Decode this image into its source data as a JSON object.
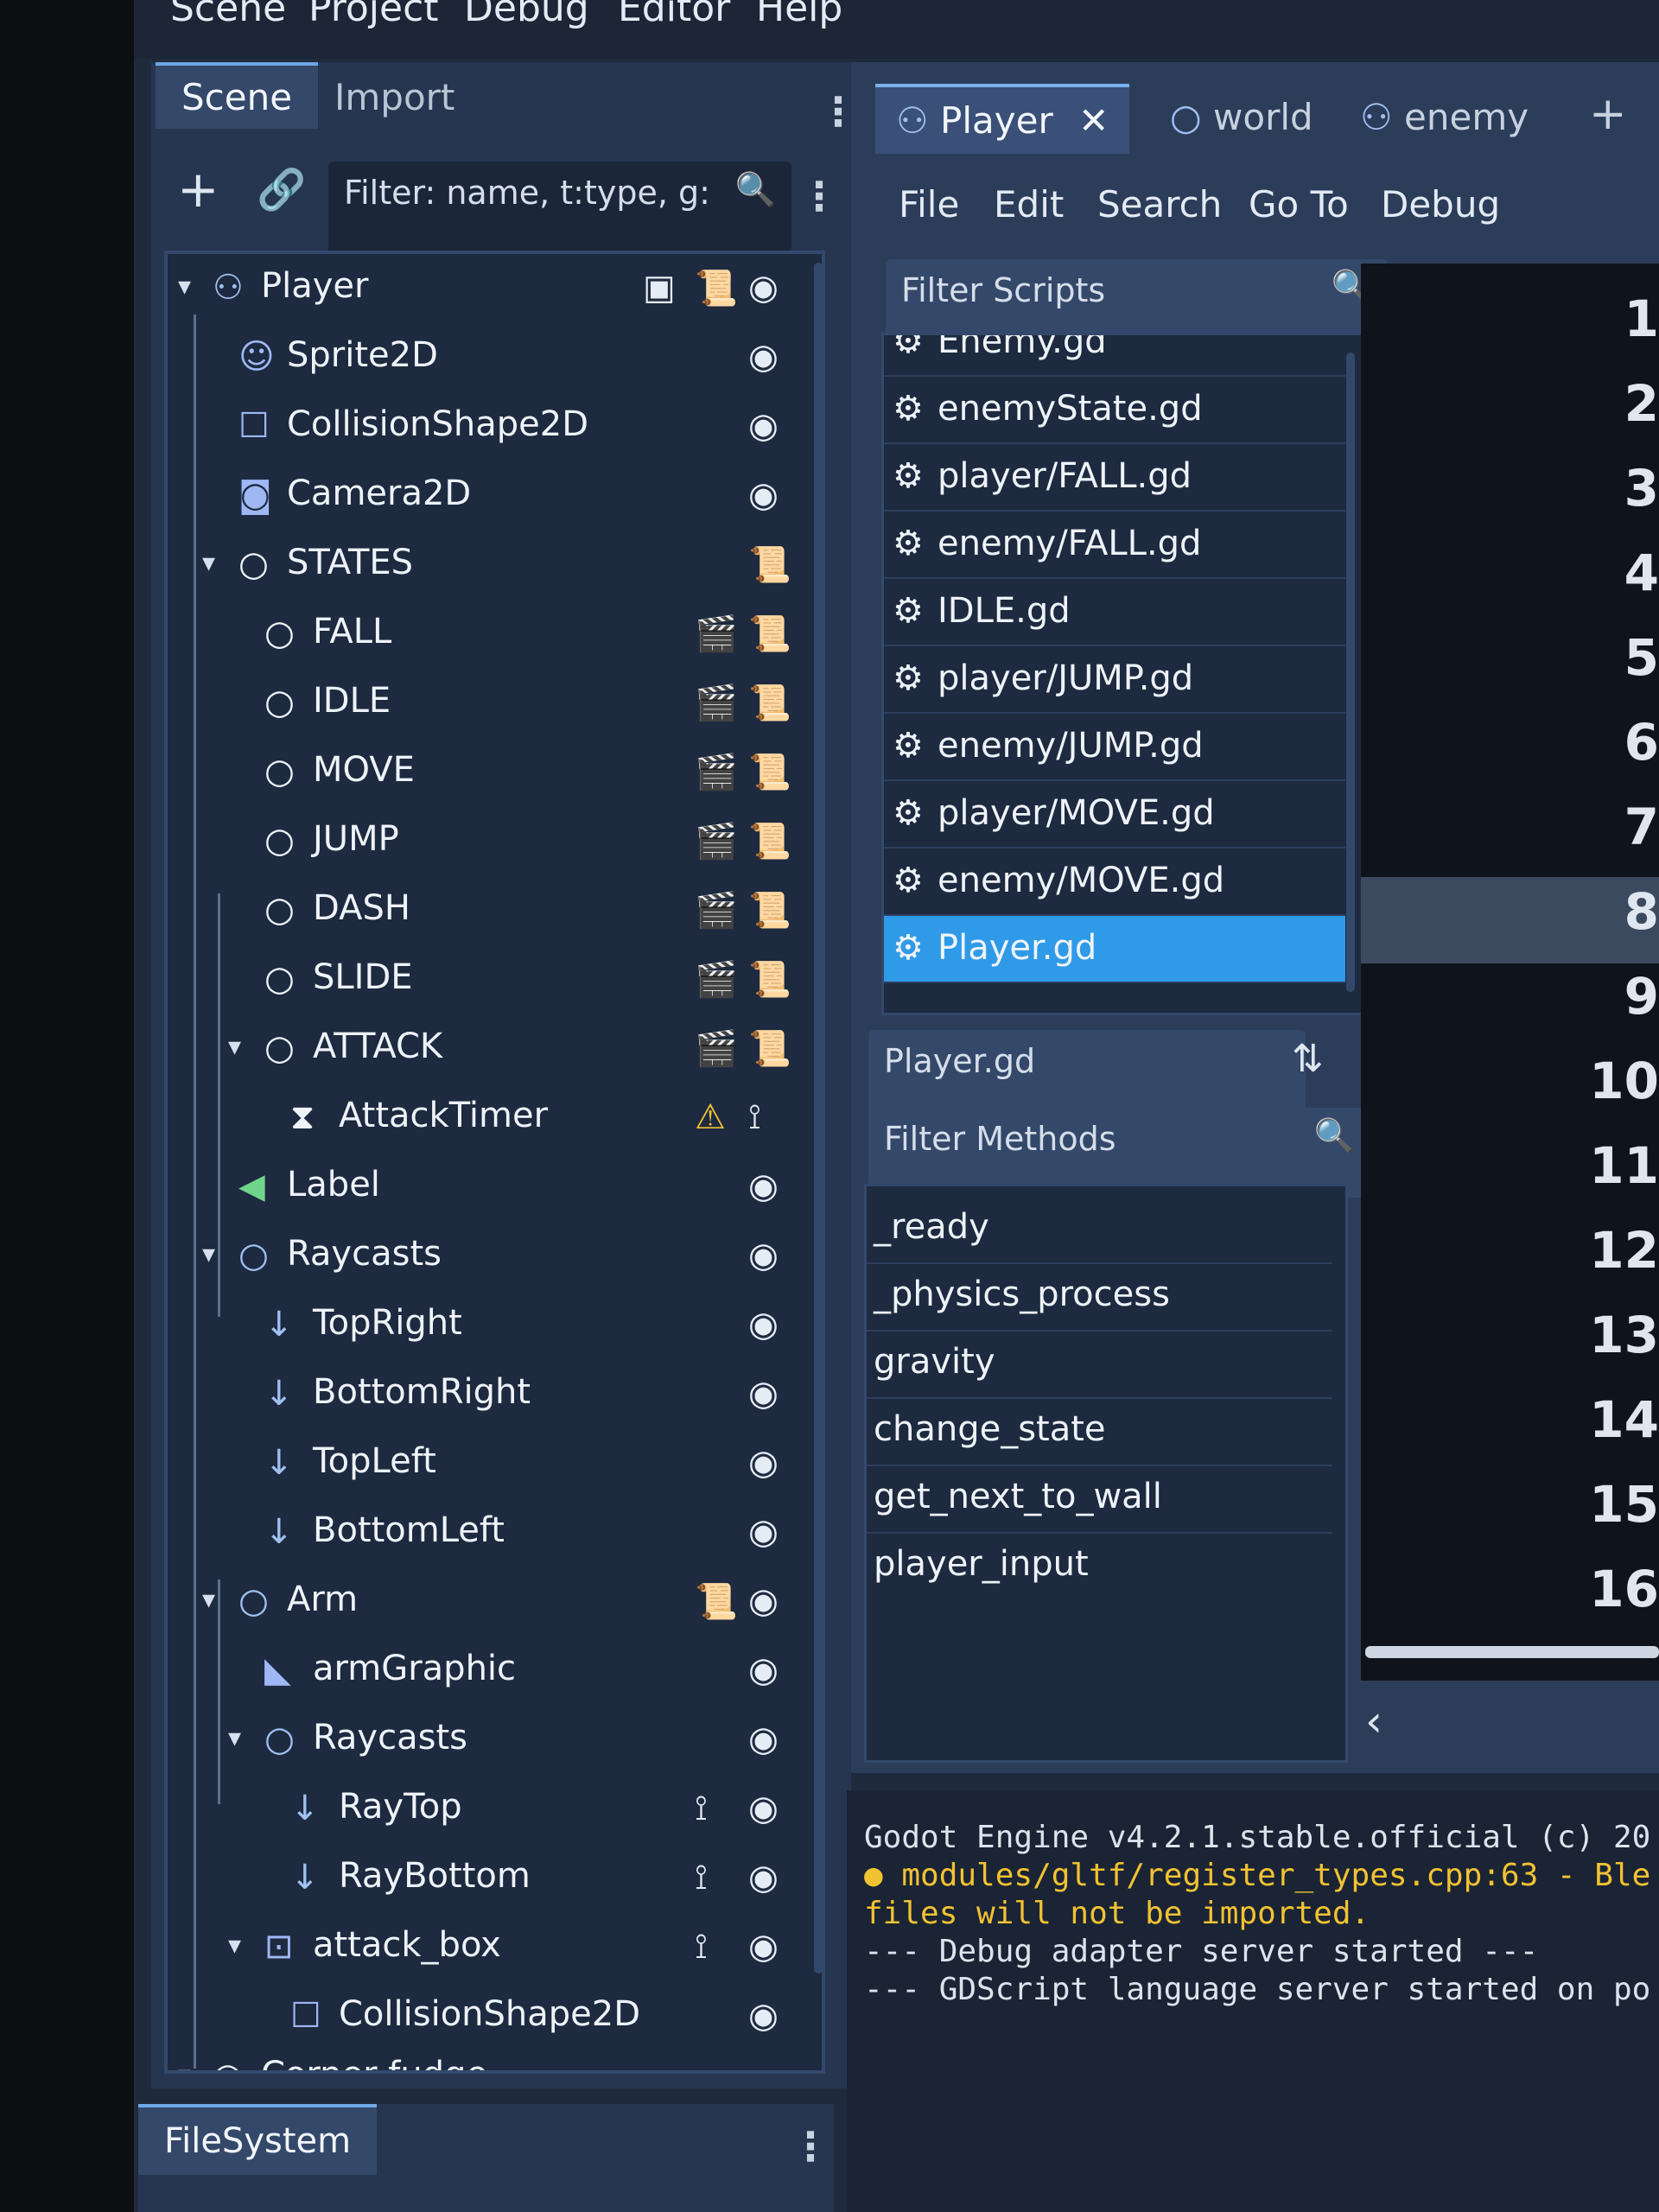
{
  "menubar": {
    "items": [
      "Scene",
      "Project",
      "Debug",
      "Editor",
      "Help"
    ]
  },
  "scene_dock": {
    "tabs": [
      "Scene",
      "Import"
    ],
    "filter_placeholder": "Filter: name, t:type, g:"
  },
  "scene_tree": {
    "nodes": [
      {
        "label": "Player",
        "icon": "player-node-icon"
      },
      {
        "label": "Sprite2D",
        "icon": "sprite-icon"
      },
      {
        "label": "CollisionShape2D",
        "icon": "collision-shape-icon"
      },
      {
        "label": "Camera2D",
        "icon": "camera-icon"
      },
      {
        "label": "STATES",
        "icon": "node-circle-icon"
      },
      {
        "label": "FALL",
        "icon": "node-circle-icon"
      },
      {
        "label": "IDLE",
        "icon": "node-circle-icon"
      },
      {
        "label": "MOVE",
        "icon": "node-circle-icon"
      },
      {
        "label": "JUMP",
        "icon": "node-circle-icon"
      },
      {
        "label": "DASH",
        "icon": "node-circle-icon"
      },
      {
        "label": "SLIDE",
        "icon": "node-circle-icon"
      },
      {
        "label": "ATTACK",
        "icon": "node-circle-icon"
      },
      {
        "label": "AttackTimer",
        "icon": "timer-icon"
      },
      {
        "label": "Label",
        "icon": "label-icon"
      },
      {
        "label": "Raycasts",
        "icon": "node-circle-icon"
      },
      {
        "label": "TopRight",
        "icon": "raycast-arrow-icon"
      },
      {
        "label": "BottomRight",
        "icon": "raycast-arrow-icon"
      },
      {
        "label": "TopLeft",
        "icon": "raycast-arrow-icon"
      },
      {
        "label": "BottomLeft",
        "icon": "raycast-arrow-icon"
      },
      {
        "label": "Arm",
        "icon": "node-circle-icon"
      },
      {
        "label": "armGraphic",
        "icon": "polygon-icon"
      },
      {
        "label": "Raycasts",
        "icon": "node-circle-icon"
      },
      {
        "label": "RayTop",
        "icon": "raycast-arrow-icon"
      },
      {
        "label": "RayBottom",
        "icon": "raycast-arrow-icon"
      },
      {
        "label": "attack_box",
        "icon": "area-icon"
      },
      {
        "label": "CollisionShape2D",
        "icon": "collision-shape-icon"
      },
      {
        "label": "Corner fudge",
        "icon": "node-circle-icon"
      }
    ]
  },
  "scene_tabs": [
    {
      "label": "Player",
      "icon": "player-node-icon"
    },
    {
      "label": "world",
      "icon": "node-circle-icon"
    },
    {
      "label": "enemy",
      "icon": "player-node-icon"
    }
  ],
  "script_menu": [
    "File",
    "Edit",
    "Search",
    "Go To",
    "Debug"
  ],
  "scripts": {
    "filter_placeholder": "Filter Scripts",
    "items": [
      "Enemy.gd",
      "enemyState.gd",
      "player/FALL.gd",
      "enemy/FALL.gd",
      "IDLE.gd",
      "player/JUMP.gd",
      "enemy/JUMP.gd",
      "player/MOVE.gd",
      "enemy/MOVE.gd",
      "Player.gd"
    ],
    "selected": "Player.gd"
  },
  "current_script": "Player.gd",
  "methods": {
    "filter_placeholder": "Filter Methods",
    "items": [
      "_ready",
      "_physics_process",
      "gravity",
      "change_state",
      "get_next_to_wall",
      "player_input"
    ]
  },
  "code": {
    "line_numbers": [
      "1",
      "2",
      "3",
      "4",
      "5",
      "6",
      "7",
      "8",
      "9",
      "10",
      "11",
      "12",
      "13",
      "14",
      "15",
      "16"
    ],
    "current_line": "8"
  },
  "output": {
    "lines": [
      "Godot Engine v4.2.1.stable.official (c) 20",
      "● modules/gltf/register_types.cpp:63 - Ble",
      "files will not be imported.",
      "--- Debug adapter server started ---",
      "--- GDScript language server started on po"
    ]
  },
  "filesystem": {
    "tab_label": "FileSystem"
  },
  "colors": {
    "panel": "#263650",
    "tree_bg": "#1d2a3f",
    "accent": "#2f9ae8",
    "warning": "#f1c232",
    "code_bg": "#0f141c"
  }
}
